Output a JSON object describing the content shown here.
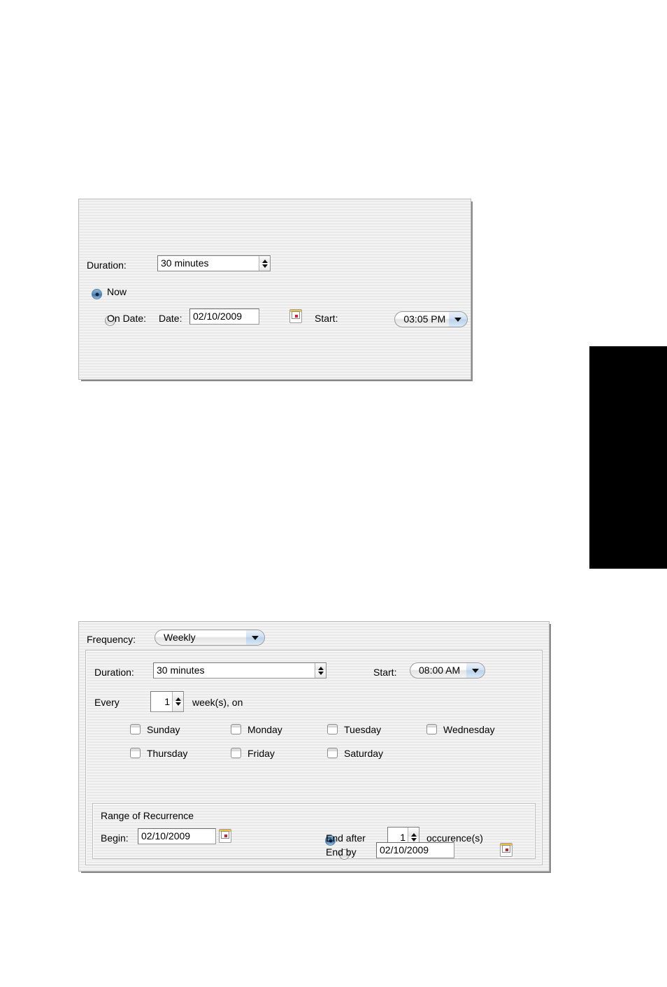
{
  "schedule_panel": {
    "duration": {
      "label": "Duration:",
      "value": "30 minutes"
    },
    "now": {
      "label": "Now",
      "selected": true
    },
    "on_date": {
      "label": "On Date:",
      "selected": false,
      "date_label": "Date:",
      "date_value": "02/10/2009",
      "calendar_icon": "calendar-icon"
    },
    "start": {
      "label": "Start:",
      "value": "03:05 PM"
    }
  },
  "recurrence_panel": {
    "frequency": {
      "label": "Frequency:",
      "value": "Weekly"
    },
    "duration": {
      "label": "Duration:",
      "value": "30 minutes"
    },
    "start": {
      "label": "Start:",
      "value": "08:00 AM"
    },
    "every": {
      "prefix": "Every",
      "value": "1",
      "suffix": "week(s), on"
    },
    "days": [
      {
        "label": "Sunday",
        "checked": false
      },
      {
        "label": "Monday",
        "checked": false
      },
      {
        "label": "Tuesday",
        "checked": false
      },
      {
        "label": "Wednesday",
        "checked": false
      },
      {
        "label": "Thursday",
        "checked": false
      },
      {
        "label": "Friday",
        "checked": false
      },
      {
        "label": "Saturday",
        "checked": false
      }
    ],
    "range": {
      "title": "Range of Recurrence",
      "begin": {
        "label": "Begin:",
        "value": "02/10/2009",
        "calendar_icon": "calendar-icon"
      },
      "end_after": {
        "label": "End after",
        "selected": true,
        "value": "1",
        "suffix": "occurence(s)"
      },
      "end_by": {
        "label": "End by",
        "selected": false,
        "value": "02/10/2009",
        "calendar_icon": "calendar-icon"
      }
    }
  },
  "colors": {
    "panel_background": "#eeeeee",
    "panel_border": "#b8b8b8",
    "panel_shadow": "#888888",
    "radio_selected": "#3f7bb3",
    "popup_arrow_well": "#b9d2ec",
    "calendar_bar": "#f0c040",
    "calendar_dot": "#d0202a",
    "page_tab": "#000000"
  }
}
